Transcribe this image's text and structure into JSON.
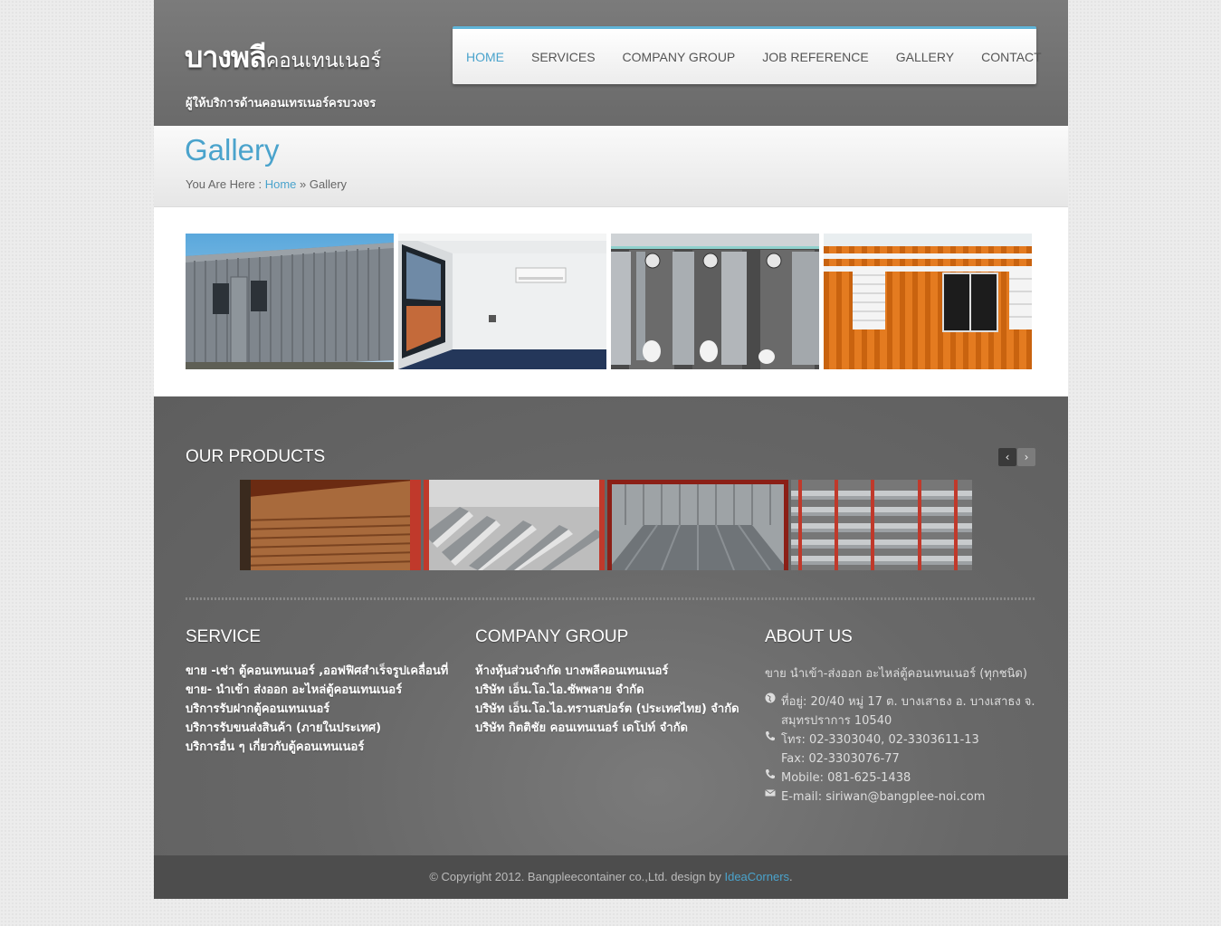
{
  "header": {
    "logo_main": "บางพลี",
    "logo_sub": "คอนเทนเนอร์",
    "tagline": "ผู้ให้บริการด้านคอนเทรเนอร์ครบวงจร"
  },
  "nav": {
    "items": [
      "HOME",
      "SERVICES",
      "COMPANY GROUP",
      "JOB REFERENCE",
      "GALLERY",
      "CONTACT"
    ],
    "active": "HOME"
  },
  "title_band": {
    "title": "Gallery",
    "breadcrumb_prefix": "You Are Here :",
    "breadcrumb_home": "Home",
    "breadcrumb_sep": "»",
    "breadcrumb_current": "Gallery"
  },
  "products": {
    "title": "OUR PRODUCTS"
  },
  "service": {
    "title": "SERVICE",
    "items": [
      "ขาย -เช่า ตู้คอนเทนเนอร์ ,ออฟฟิศสำเร็จรูปเคลื่อนที่",
      "ขาย- นำเข้า ส่งออก อะไหล่ตู้คอนเทนเนอร์",
      "บริการรับฝากตู้คอนเทนเนอร์",
      "บริการรับขนส่งสินค้า (ภายในประเทศ)",
      "บริการอื่น ๆ เกี่ยวกับตู้คอนเทนเนอร์"
    ]
  },
  "company_group": {
    "title": "COMPANY GROUP",
    "items": [
      "ห้างหุ้นส่วนจำกัด บางพลีคอนเทนเนอร์",
      "บริษัท เอ็น.โอ.ไอ.ซัพพลาย จำกัด",
      "บริษัท เอ็น.โอ.ไอ.ทรานสปอร์ต (ประเทศไทย) จำกัด",
      "บริษัท กิตติชัย คอนเทนเนอร์ เดโปท์ จำกัด"
    ]
  },
  "about": {
    "title": "ABOUT US",
    "intro": "ขาย นำเข้า-ส่งออก อะไหล่ตู้คอนเทนเนอร์ (ทุกชนิด)",
    "address_1": "ที่อยู่: 20/40 หมู่ 17 ต. บางเสาธง อ. บางเสาธง จ.",
    "address_2": "สมุทรปราการ 10540",
    "phone": "โทร: 02-3303040, 02-3303611-13",
    "fax": "Fax: 02-3303076-77",
    "mobile": "Mobile: 081-625-1438",
    "email": "E-mail: siriwan@bangplee-noi.com"
  },
  "footer": {
    "copyright": "© Copyright 2012. Bangpleecontainer co.,Ltd. design by",
    "link": "IdeaCorners",
    "end": "."
  }
}
